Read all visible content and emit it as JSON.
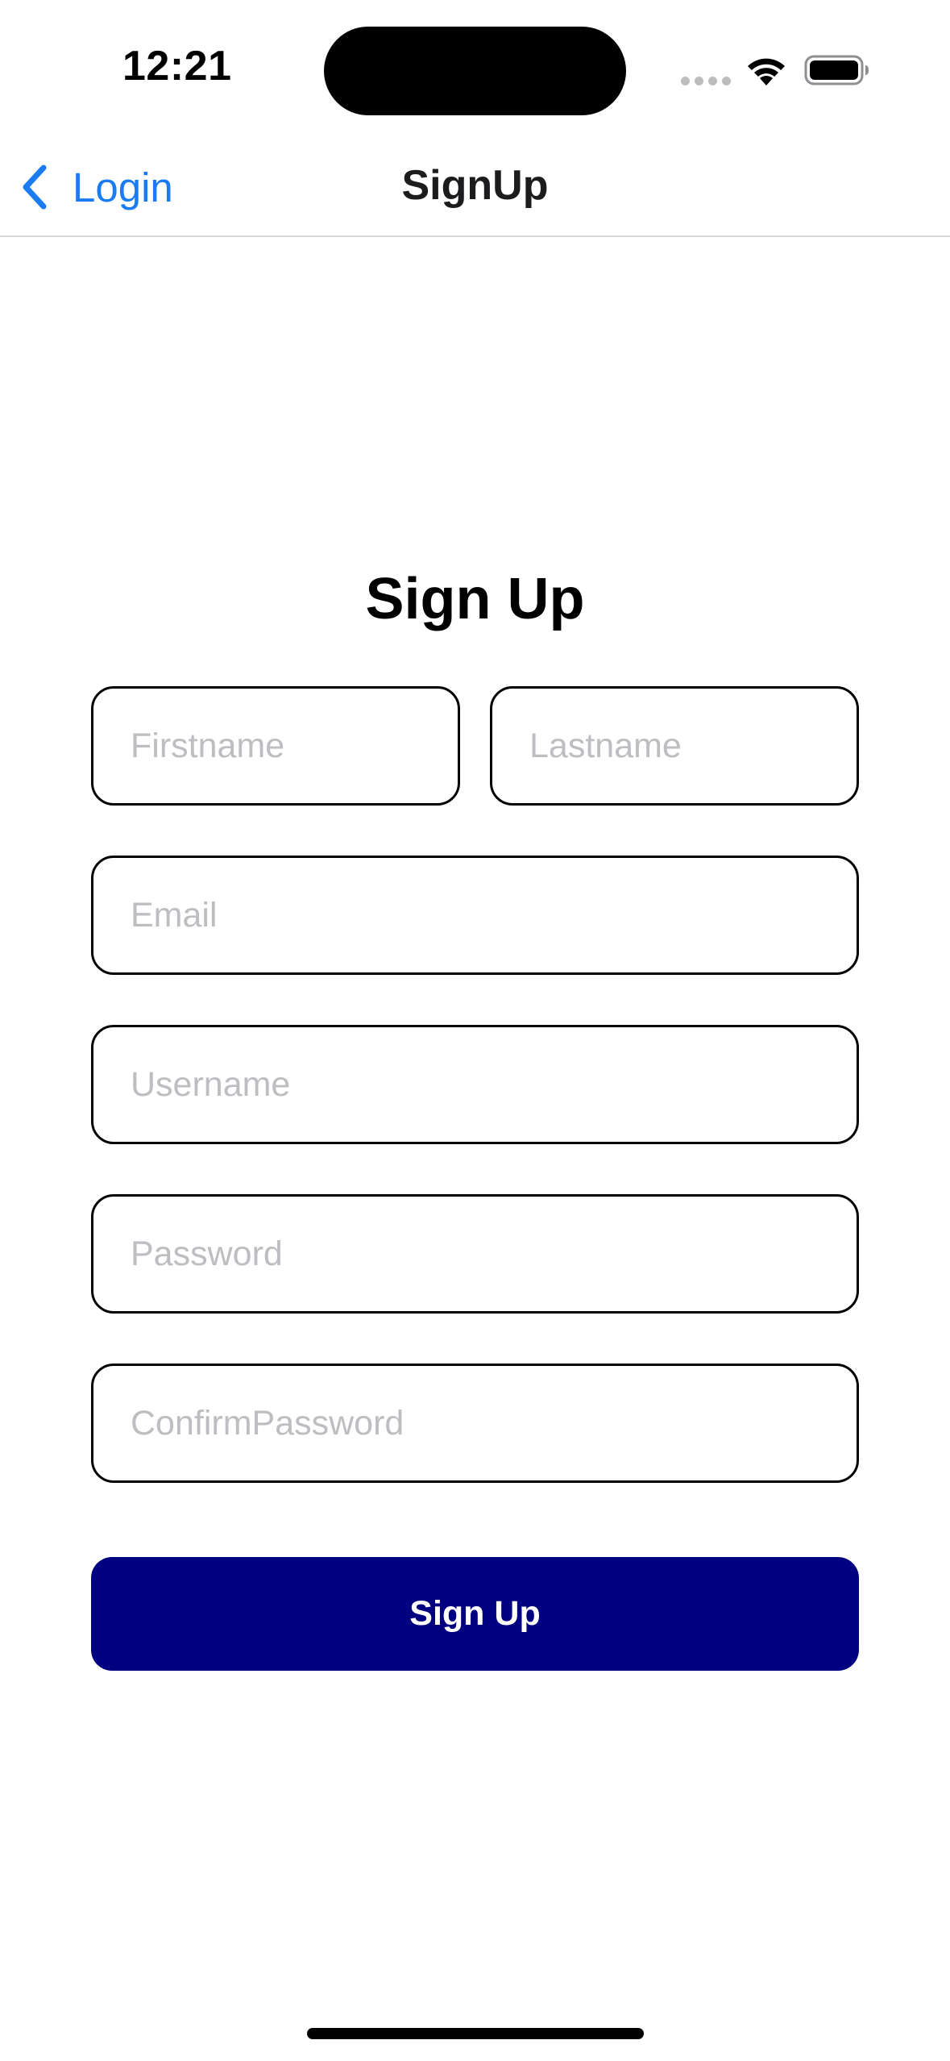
{
  "status_bar": {
    "time": "12:21",
    "icons": [
      "signal-dots-icon",
      "wifi-icon",
      "battery-icon"
    ]
  },
  "nav": {
    "back_label": "Login",
    "title": "SignUp",
    "back_icon": "chevron-left-icon",
    "accent_color": "#1b7cf2"
  },
  "form": {
    "title": "Sign Up",
    "fields": {
      "firstname": {
        "placeholder": "Firstname",
        "value": ""
      },
      "lastname": {
        "placeholder": "Lastname",
        "value": ""
      },
      "email": {
        "placeholder": "Email",
        "value": ""
      },
      "username": {
        "placeholder": "Username",
        "value": ""
      },
      "password": {
        "placeholder": "Password",
        "value": ""
      },
      "confirm_password": {
        "placeholder": "ConfirmPassword",
        "value": ""
      }
    },
    "submit_label": "Sign Up",
    "submit_color": "#000080"
  }
}
